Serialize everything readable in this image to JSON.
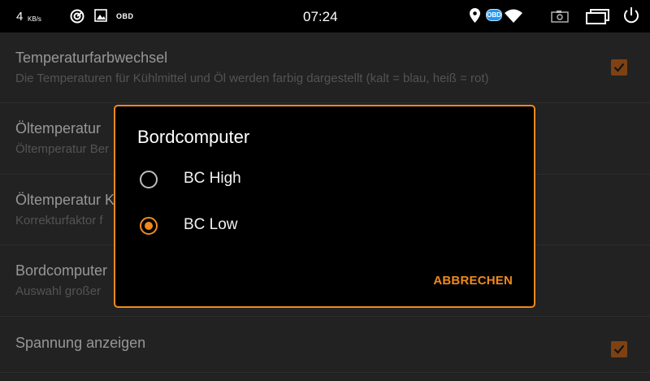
{
  "colors": {
    "accent": "#f08a1c",
    "obd_badge": "#2196f3",
    "checkbox_fill": "#a8571a"
  },
  "status_bar": {
    "speed_value": "4",
    "speed_unit": "KB/s",
    "obd_label": "OBD",
    "time": "07:24",
    "obd_badge": "OBD",
    "icons": [
      "gauge-icon",
      "image-icon",
      "location-icon",
      "wifi-icon",
      "screenshot-icon",
      "windows-icon",
      "power-icon"
    ]
  },
  "settings": [
    {
      "title": "Temperaturfarbwechsel",
      "subtitle": "Die Temperaturen für Kühlmittel und Öl werden farbig dargestellt (kalt = blau, heiß = rot)",
      "checked": true
    },
    {
      "title": "Öltemperatur",
      "subtitle": "Öltemperatur Ber"
    },
    {
      "title": "Öltemperatur K",
      "subtitle": "Korrekturfaktor f"
    },
    {
      "title": "Bordcomputer",
      "subtitle": "Auswahl großer "
    },
    {
      "title": "Spannung anzeigen",
      "subtitle": "",
      "checked": true
    }
  ],
  "dialog": {
    "title": "Bordcomputer",
    "options": [
      {
        "label": "BC High",
        "selected": false
      },
      {
        "label": "BC Low",
        "selected": true
      }
    ],
    "cancel_label": "ABBRECHEN"
  }
}
